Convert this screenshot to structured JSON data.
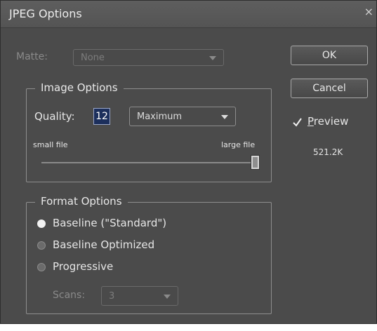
{
  "dialog": {
    "title": "JPEG Options",
    "close_glyph": "×"
  },
  "matte": {
    "label": "Matte:",
    "value": "None"
  },
  "buttons": {
    "ok": "OK",
    "cancel": "Cancel"
  },
  "preview": {
    "checked": true,
    "label_first": "P",
    "label_rest": "review",
    "size": "521.2K"
  },
  "image_options": {
    "legend": "Image Options",
    "quality_label": "Quality:",
    "quality_value": "12",
    "quality_preset": "Maximum",
    "small_label": "small file",
    "large_label": "large file",
    "slider_position": 1.0
  },
  "format_options": {
    "legend": "Format Options",
    "options": [
      {
        "label": "Baseline (\"Standard\")",
        "selected": true
      },
      {
        "label": "Baseline Optimized",
        "selected": false
      },
      {
        "label": "Progressive",
        "selected": false
      }
    ],
    "scans_label": "Scans:",
    "scans_value": "3"
  }
}
